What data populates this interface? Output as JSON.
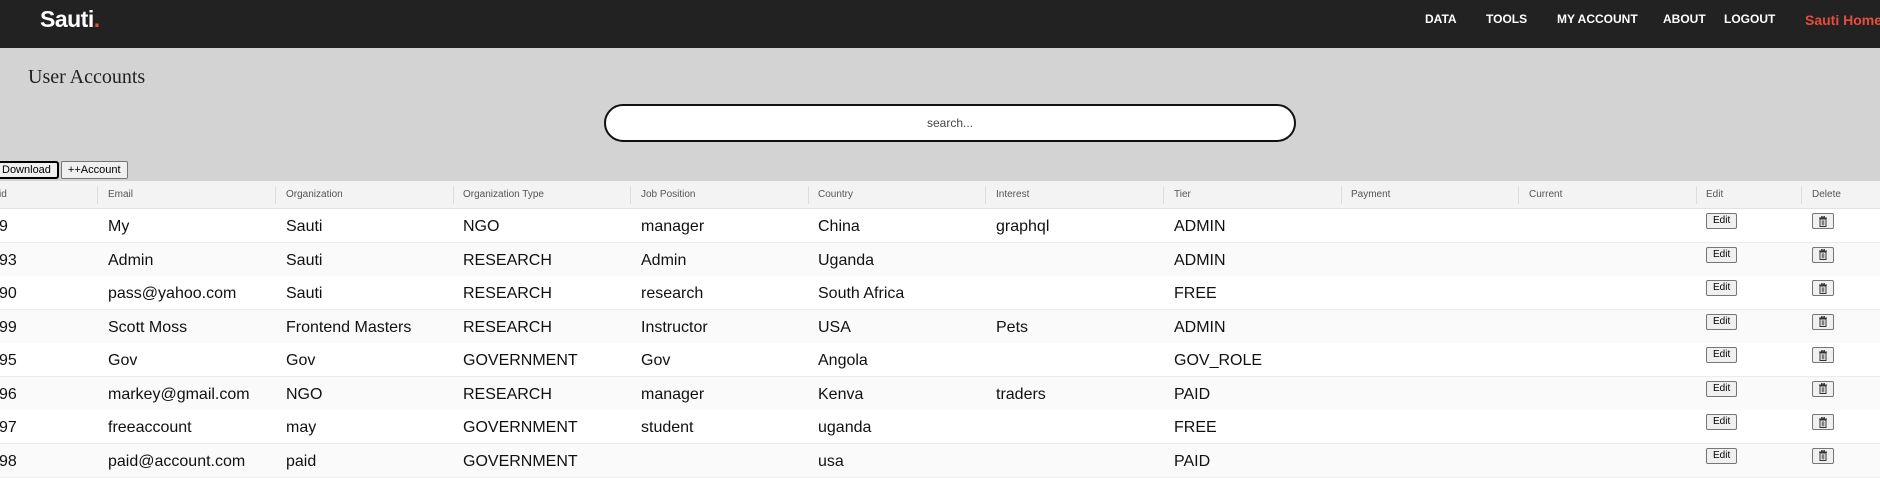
{
  "navbar": {
    "logo_text": "Sauti",
    "logo_dot": ".",
    "items": [
      "DATA",
      "TOOLS",
      "MY ACCOUNT",
      "ABOUT",
      "LOGOUT"
    ],
    "home_label": "Sauti Home",
    "accent_color": "#e74c3c"
  },
  "page": {
    "title": "User Accounts",
    "search_placeholder": "search...",
    "download_label": "Download",
    "add_account_label": "++Account"
  },
  "table": {
    "columns": [
      "id",
      "Email",
      "Organization",
      "Organization Type",
      "Job Position",
      "Country",
      "Interest",
      "Tier",
      "Payment",
      "Current",
      "Edit",
      "Delete"
    ],
    "edit_label": "Edit",
    "delete_icon": "trash-icon",
    "rows": [
      [
        "9",
        "My",
        "Sauti",
        "NGO",
        "manager",
        "China",
        "graphql",
        "ADMIN",
        "",
        ""
      ],
      [
        "93",
        "Admin",
        "Sauti",
        "RESEARCH",
        "Admin",
        "Uganda",
        "",
        "ADMIN",
        "",
        ""
      ],
      [
        "90",
        "pass@yahoo.com",
        "Sauti",
        "RESEARCH",
        "research",
        "South Africa",
        "",
        "FREE",
        "",
        ""
      ],
      [
        "99",
        "Scott Moss",
        "Frontend Masters",
        "RESEARCH",
        "Instructor",
        "USA",
        "Pets",
        "ADMIN",
        "",
        ""
      ],
      [
        "95",
        "Gov",
        "Gov",
        "GOVERNMENT",
        "Gov",
        "Angola",
        "",
        "GOV_ROLE",
        "",
        ""
      ],
      [
        "96",
        "markey@gmail.com",
        "NGO",
        "RESEARCH",
        "manager",
        "Kenva",
        "traders",
        "PAID",
        "",
        ""
      ],
      [
        "97",
        "freeaccount",
        "may",
        "GOVERNMENT",
        "student",
        "uganda",
        "",
        "FREE",
        "",
        ""
      ],
      [
        "98",
        "paid@account.com",
        "paid",
        "GOVERNMENT",
        "",
        "usa",
        "",
        "PAID",
        "",
        ""
      ]
    ]
  }
}
